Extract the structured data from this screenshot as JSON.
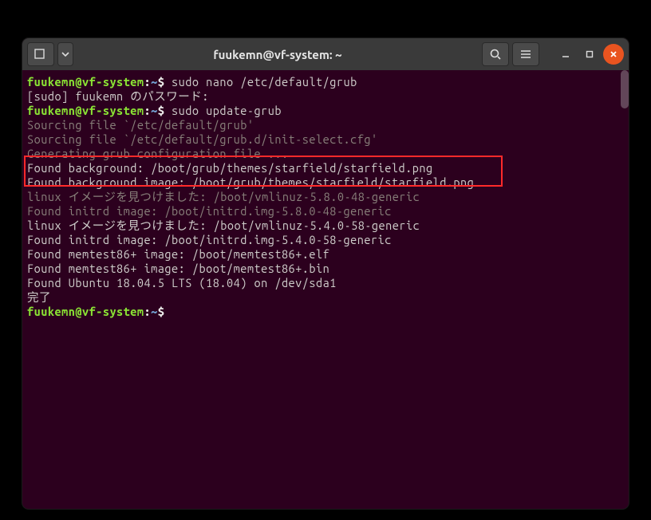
{
  "titlebar": {
    "title": "fuukemn@vf-system: ~"
  },
  "prompt": {
    "user_host": "fuukemn@vf-system",
    "separator": ":",
    "path": "~",
    "symbol": "$"
  },
  "lines": {
    "cmd1": " sudo nano /etc/default/grub",
    "sudo_pw": "[sudo] fuukemn のパスワード:",
    "cmd2": " sudo update-grub",
    "src1": "Sourcing file `/etc/default/grub'",
    "src2": "Sourcing file `/etc/default/grub.d/init-select.cfg'",
    "gen": "Generating grub configuration file ...",
    "bg1": "Found background: /boot/grub/themes/starfield/starfield.png",
    "bg2": "Found background image: /boot/grub/themes/starfield/starfield.png",
    "linux1": "linux イメージを見つけました: /boot/vmlinuz-5.8.0-48-generic",
    "initrd1": "Found initrd image: /boot/initrd.img-5.8.0-48-generic",
    "linux2": "linux イメージを見つけました: /boot/vmlinuz-5.4.0-58-generic",
    "initrd2": "Found initrd image: /boot/initrd.img-5.4.0-58-generic",
    "mem1": "Found memtest86+ image: /boot/memtest86+.elf",
    "mem2": "Found memtest86+ image: /boot/memtest86+.bin",
    "ubuntu": "Found Ubuntu 18.04.5 LTS (18.04) on /dev/sda1",
    "done": "完了",
    "blank": " "
  }
}
